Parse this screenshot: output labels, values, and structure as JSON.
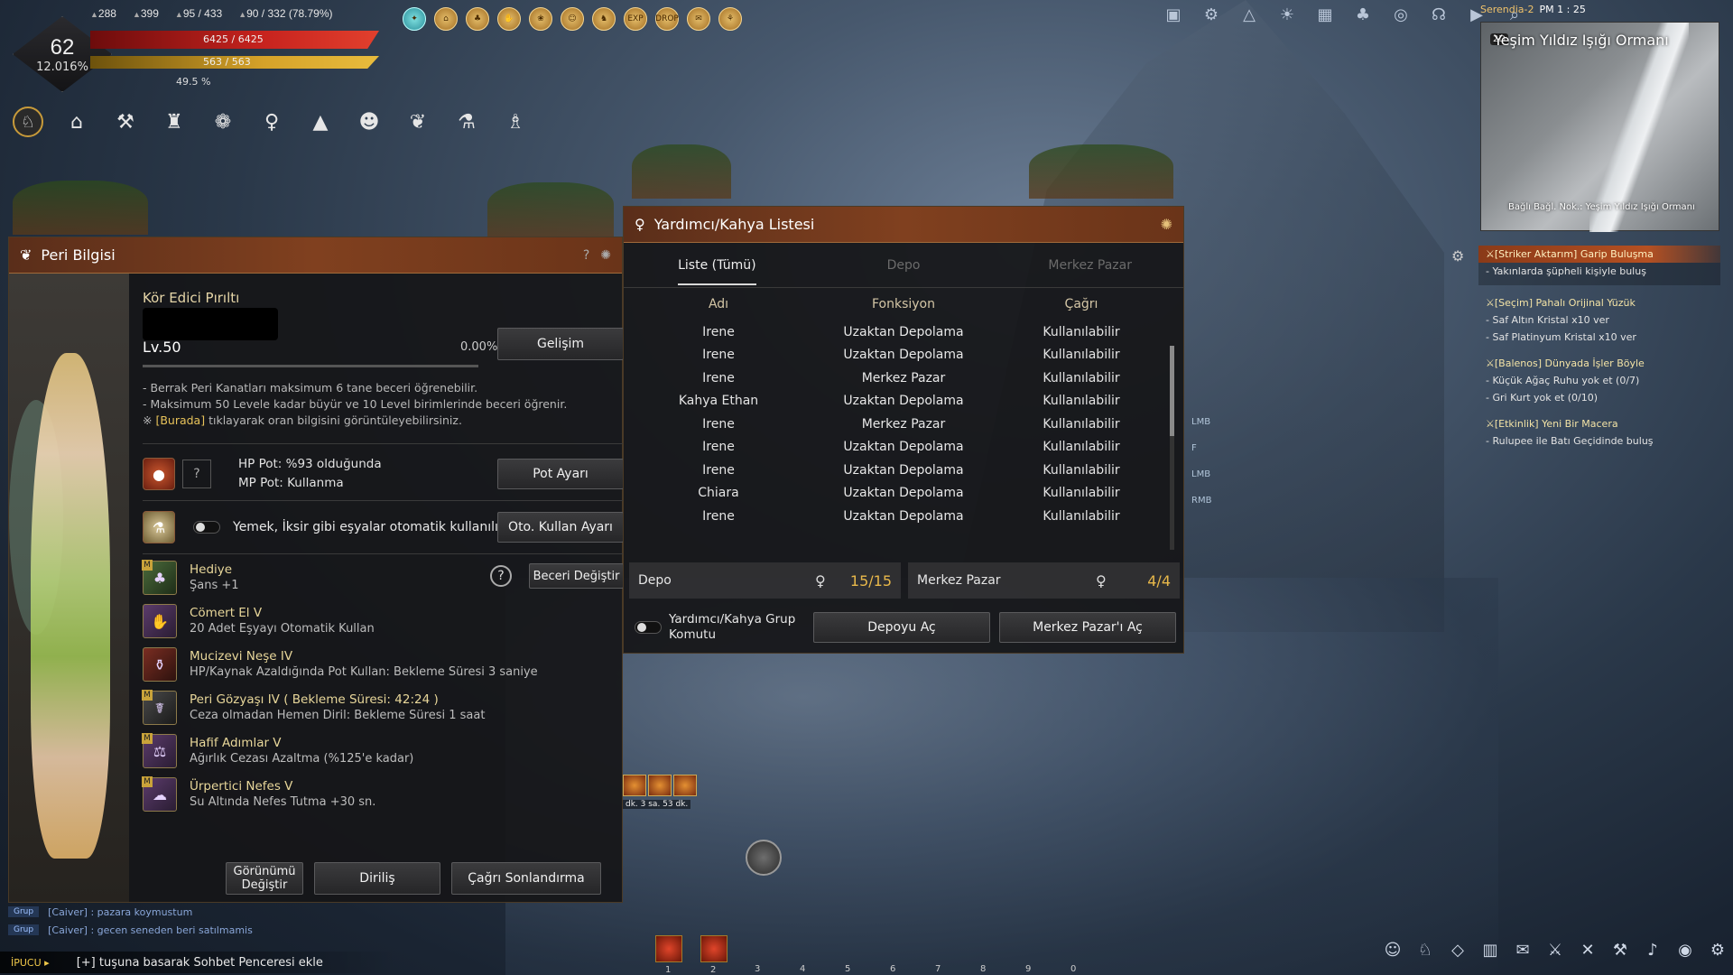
{
  "player": {
    "level": "62",
    "exp_pct": "12.016%",
    "hp": "6425 / 6425",
    "mp": "563 / 563",
    "stamina_pct": "49.5 %",
    "ap": "288",
    "dp": "399",
    "weight": "95 / 433",
    "inventory": "90 / 332 (78.79%)"
  },
  "top_icons": [
    "EXP",
    "DROP"
  ],
  "server": {
    "name": "Serendia-2",
    "time": "PM 1 : 25"
  },
  "minimap": {
    "mode": "2D",
    "title": "Yeşim Yıldız Işığı Ormanı",
    "subtitle": "Bağlı Bağl. Nok.: Yeşim Yıldız Işığı Ormanı"
  },
  "quests": [
    {
      "title": "[Striker Aktarım] Garip Buluşma",
      "items": [
        "- Yakınlarda şüpheli kişiyle buluş"
      ],
      "active": true
    },
    {
      "title": "[Seçim] Pahalı Orijinal Yüzük",
      "items": [
        "- Saf Altın Kristal x10 ver",
        "- Saf Platinyum Kristal x10 ver"
      ]
    },
    {
      "title": "[Balenos] Dünyada İşler Böyle",
      "items": [
        "- Küçük Ağaç Ruhu yok et (0/7)",
        "- Gri Kurt yok et (0/10)"
      ]
    },
    {
      "title": "[Etkinlik] Yeni Bir Macera",
      "items": [
        "- Rulupee ile Batı Geçidinde buluş"
      ]
    }
  ],
  "keyhints": {
    "lmb1": "LMB",
    "f": "F",
    "lmb2": "LMB",
    "rmb": "RMB"
  },
  "fairy": {
    "title": "Peri Bilgisi",
    "name": "Kör Edici Pırıltı",
    "level": "Lv.50",
    "progress": "0.00%",
    "grow_button": "Gelişim",
    "notes": [
      "- Berrak Peri Kanatları maksimum 6 tane beceri öğrenebilir.",
      "- Maksimum 50 Levele kadar büyür ve 10 Level birimlerinde beceri öğrenir."
    ],
    "link_prefix": "※ ",
    "link_word": "[Burada]",
    "link_suffix": " tıklayarak oran bilgisini görüntüleyebilirsiniz.",
    "hp_pot": "HP Pot: %93 olduğunda",
    "mp_pot": "MP Pot: Kullanma",
    "pot_button": "Pot Ayarı",
    "auto_text": "Yemek, İksir gibi eşyalar otomatik kullanılır.",
    "auto_button": "Oto. Kullan Ayarı",
    "skill_button": "Beceri Değiştir",
    "skills": [
      {
        "name": "Hediye",
        "desc": "Şans +1"
      },
      {
        "name": "Cömert El V",
        "desc": "20 Adet Eşyayı Otomatik Kullan"
      },
      {
        "name": "Mucizevi Neşe IV",
        "desc": "HP/Kaynak Azaldığında Pot Kullan: Bekleme Süresi 3 saniye"
      },
      {
        "name": "Peri Gözyaşı IV  ( Bekleme Süresi: 42:24 )",
        "desc": "Ceza olmadan Hemen Diril: Bekleme Süresi 1 saat"
      },
      {
        "name": "Hafif Adımlar V",
        "desc": "Ağırlık Cezası Azaltma (%125'e kadar)"
      },
      {
        "name": "Ürpertici Nefes V",
        "desc": "Su Altında Nefes Tutma +30 sn."
      }
    ],
    "bottom_buttons": [
      "Görünümü Değiştir",
      "Diriliş",
      "Çağrı Sonlandırma"
    ]
  },
  "helper": {
    "title": "Yardımcı/Kahya Listesi",
    "tabs": [
      "Liste (Tümü)",
      "Depo",
      "Merkez Pazar"
    ],
    "columns": [
      "Adı",
      "Fonksiyon",
      "Çağrı"
    ],
    "rows": [
      [
        "Irene",
        "Uzaktan Depolama",
        "Kullanılabilir"
      ],
      [
        "Irene",
        "Uzaktan Depolama",
        "Kullanılabilir"
      ],
      [
        "Irene",
        "Merkez Pazar",
        "Kullanılabilir"
      ],
      [
        "Kahya Ethan",
        "Uzaktan Depolama",
        "Kullanılabilir"
      ],
      [
        "Irene",
        "Merkez Pazar",
        "Kullanılabilir"
      ],
      [
        "Irene",
        "Uzaktan Depolama",
        "Kullanılabilir"
      ],
      [
        "Irene",
        "Uzaktan Depolama",
        "Kullanılabilir"
      ],
      [
        "Chiara",
        "Uzaktan Depolama",
        "Kullanılabilir"
      ],
      [
        "Irene",
        "Uzaktan Depolama",
        "Kullanılabilir"
      ]
    ],
    "depot_label": "Depo",
    "depot_value": "15/15",
    "market_label": "Merkez Pazar",
    "market_value": "4/4",
    "group_label": "Yardımcı/Kahya Grup Komutu",
    "open_depot": "Depoyu Aç",
    "open_market": "Merkez Pazar'ı Aç"
  },
  "chat": [
    {
      "tag": "Grup",
      "msg": "[Caiver] : pazara koymustum"
    },
    {
      "tag": "Grup",
      "msg": "[Caiver] : gecen seneden beri satılmamis"
    }
  ],
  "tip": {
    "label": "İPUCU ▸",
    "msg": "[+] tuşuna basarak Sohbet Penceresi ekle"
  },
  "hotbar_keys": [
    "1",
    "2",
    "3",
    "4",
    "5",
    "6",
    "7",
    "8",
    "9",
    "0"
  ],
  "buff_text": "dk. 3 sa. 53 dk."
}
